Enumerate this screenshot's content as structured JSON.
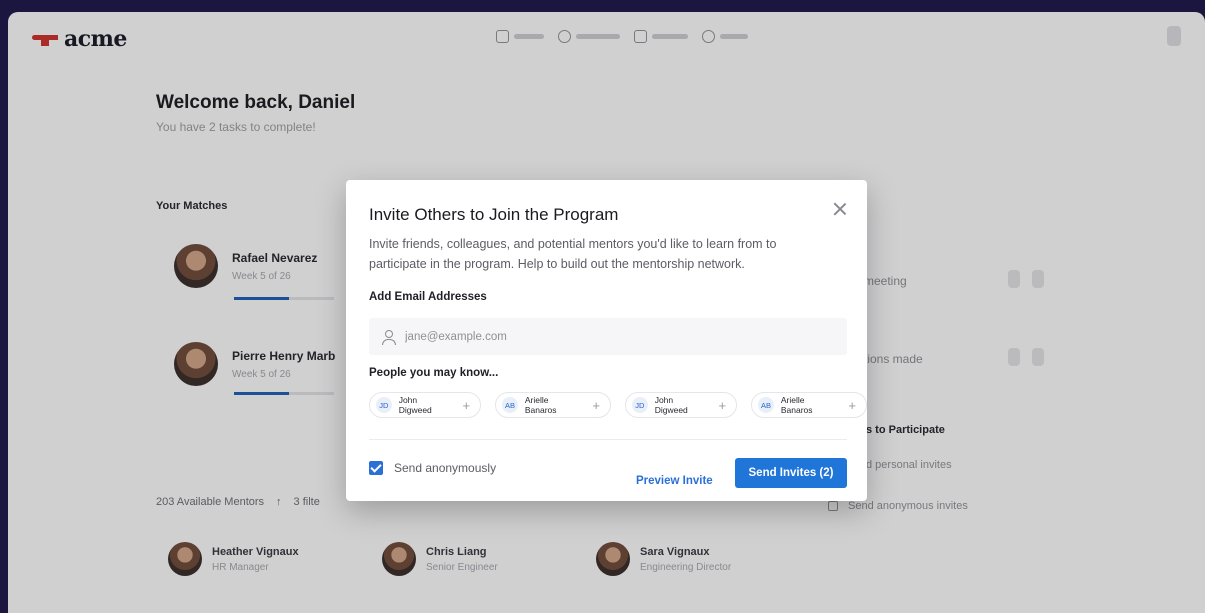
{
  "brand": {
    "name": "acme"
  },
  "welcome": {
    "title": "Welcome back, Daniel",
    "subtitle": "You have 2 tasks to complete!"
  },
  "matches": {
    "label": "Your Matches",
    "items": [
      {
        "name": "Rafael Nevarez",
        "sub": "Week 5 of 26",
        "progress": 0.55
      },
      {
        "name": "Pierre Henry Marb",
        "sub": "Week 5 of 26",
        "progress": 0.55
      }
    ]
  },
  "side": {
    "items": [
      {
        "line1": "meeting"
      },
      {
        "line1": "tions made"
      }
    ],
    "ways_title": "s to Participate",
    "ways": [
      "d personal invites",
      "Send anonymous invites"
    ]
  },
  "mentors": {
    "count_label": "203 Available Mentors",
    "filter": "3 filte",
    "items": [
      {
        "name": "Heather Vignaux",
        "role": "HR Manager"
      },
      {
        "name": "Chris Liang",
        "role": "Senior Engineer"
      },
      {
        "name": "Sara Vignaux",
        "role": "Engineering Director"
      }
    ]
  },
  "modal": {
    "title": "Invite Others to Join the Program",
    "description": "Invite friends, colleagues, and potential mentors you'd like to learn from to participate in the program. Help to build out the mentorship network.",
    "email_label": "Add Email Addresses",
    "email_placeholder": "jane@example.com",
    "email_value": "",
    "people_label": "People you may know...",
    "people": [
      {
        "initials": "JD",
        "name": "John Digweed"
      },
      {
        "initials": "AB",
        "name": "Arielle Banaros"
      },
      {
        "initials": "JD",
        "name": "John Digweed"
      },
      {
        "initials": "AB",
        "name": "Arielle Banaros"
      }
    ],
    "anonymous_label": "Send anonymously",
    "anonymous_checked": true,
    "preview_label": "Preview Invite",
    "send_label": "Send Invites (2)"
  },
  "colors": {
    "accent": "#1f75d8",
    "brand": "#c8322c",
    "frame": "#1b1640"
  }
}
